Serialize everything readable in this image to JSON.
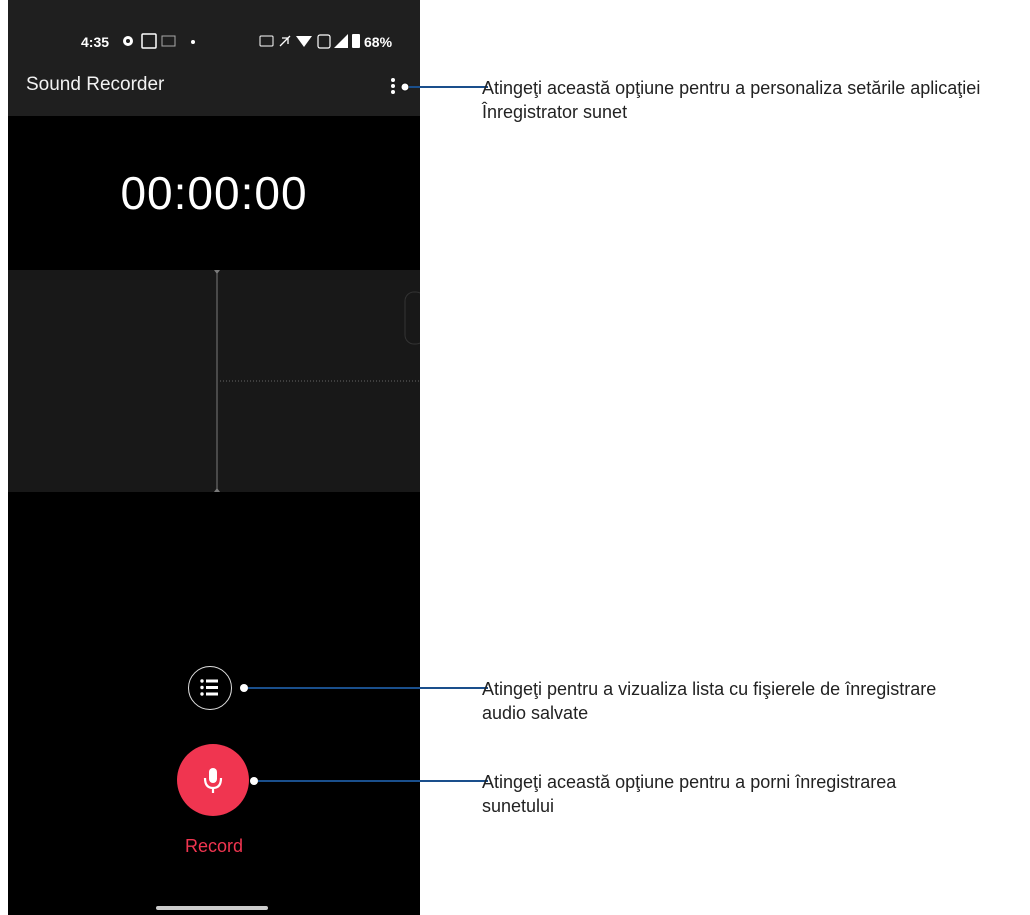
{
  "status_bar": {
    "time": "4:35",
    "battery": "68%"
  },
  "app_bar": {
    "title": "Sound Recorder",
    "menu_icon": "more-vertical-icon"
  },
  "timer": "00:00:00",
  "controls": {
    "list_icon": "list-icon",
    "record_icon": "microphone-icon",
    "record_label": "Record"
  },
  "accent_color": "#f03550",
  "callouts": {
    "settings": "Atingeţi această opţiune pentru a personaliza setările aplicaţiei Înregistrator sunet",
    "list": "Atingeţi pentru a vizualiza lista cu fişierele de înregistrare audio salvate",
    "record": "Atingeţi această opţiune pentru a porni înregistrarea sunetului"
  }
}
